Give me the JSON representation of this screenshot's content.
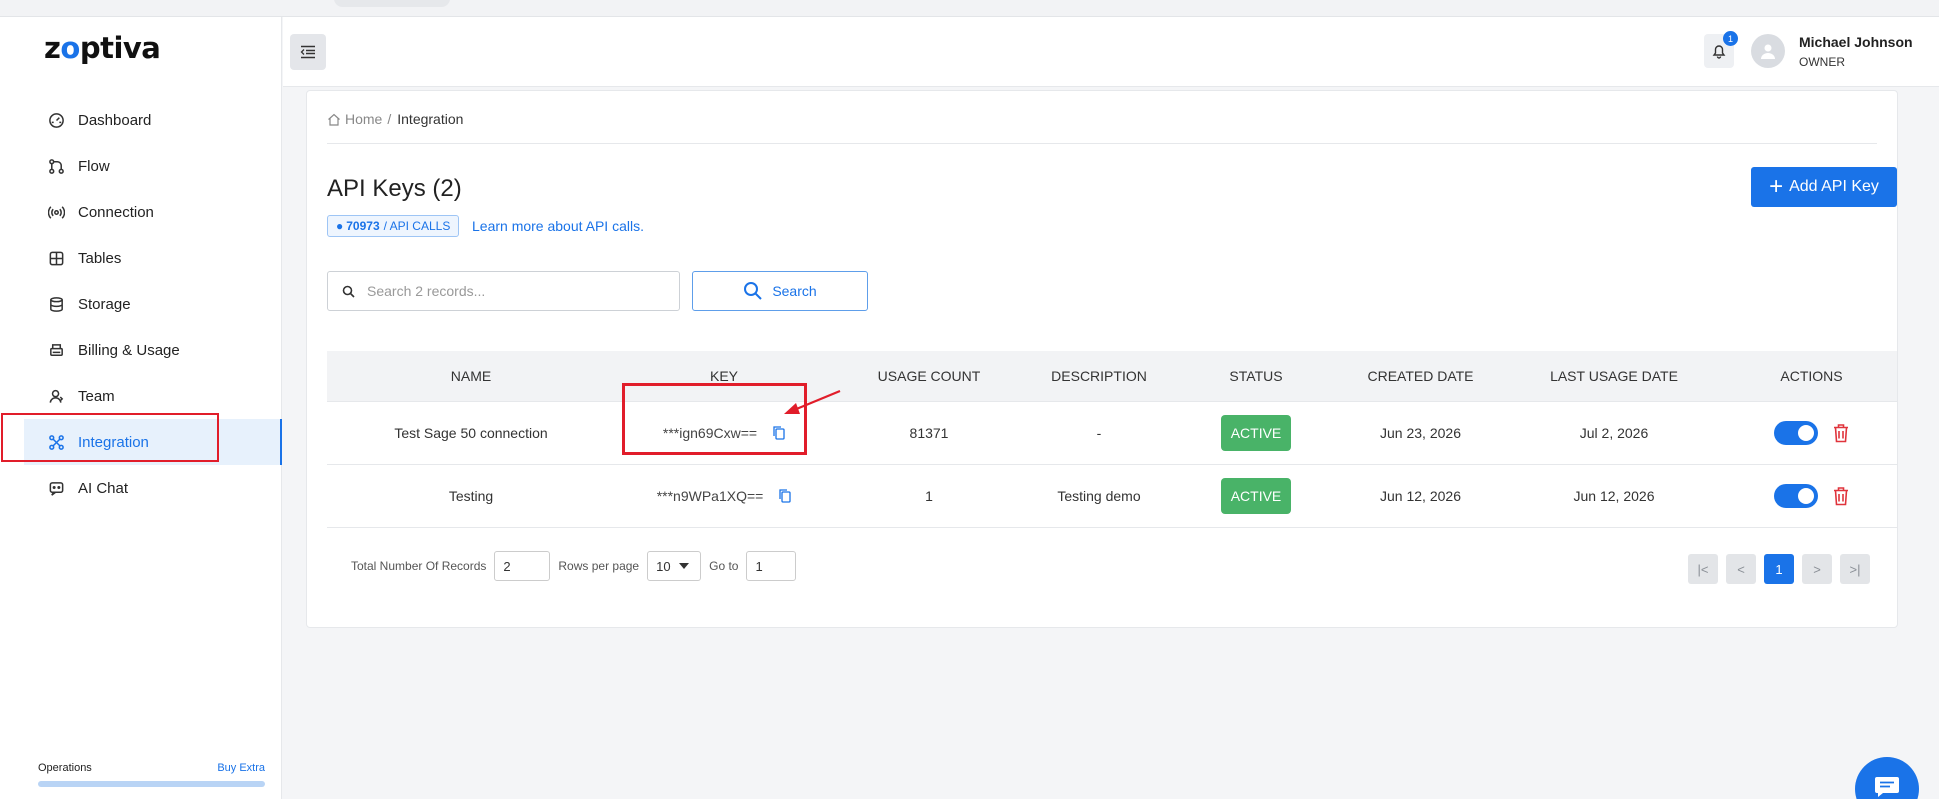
{
  "app": {
    "logo_text_before": "z",
    "logo_o": "o",
    "logo_text_after": "ptiva"
  },
  "sidebar": {
    "items": [
      {
        "label": "Dashboard",
        "icon": "dashboard-icon"
      },
      {
        "label": "Flow",
        "icon": "flow-icon"
      },
      {
        "label": "Connection",
        "icon": "connection-icon"
      },
      {
        "label": "Tables",
        "icon": "tables-icon"
      },
      {
        "label": "Storage",
        "icon": "storage-icon"
      },
      {
        "label": "Billing & Usage",
        "icon": "billing-icon"
      },
      {
        "label": "Team",
        "icon": "team-icon"
      },
      {
        "label": "Integration",
        "icon": "integration-icon",
        "active": true
      },
      {
        "label": "AI Chat",
        "icon": "ai-chat-icon"
      }
    ],
    "operations_label": "Operations",
    "buy_extra_label": "Buy Extra"
  },
  "header": {
    "notification_count": "1",
    "user_name": "Michael Johnson",
    "user_role": "OWNER"
  },
  "breadcrumb": {
    "home": "Home",
    "separator": "/",
    "current": "Integration"
  },
  "page": {
    "title": "API Keys (2)",
    "api_calls_count": "70973",
    "api_calls_label": "/ API CALLS",
    "learn_more": "Learn more about API calls.",
    "add_button": "Add API Key"
  },
  "search": {
    "placeholder": "Search 2 records...",
    "button_label": "Search"
  },
  "table": {
    "headers": [
      "NAME",
      "KEY",
      "USAGE COUNT",
      "DESCRIPTION",
      "STATUS",
      "CREATED DATE",
      "LAST USAGE DATE",
      "ACTIONS"
    ],
    "rows": [
      {
        "name": "Test Sage 50 connection",
        "key": "***ign69Cxw==",
        "usage": "81371",
        "description": "-",
        "status": "ACTIVE",
        "created": "Jun 23, 2026",
        "last_used": "Jul 2, 2026",
        "enabled": true
      },
      {
        "name": "Testing",
        "key": "***n9WPa1XQ==",
        "usage": "1",
        "description": "Testing demo",
        "status": "ACTIVE",
        "created": "Jun 12, 2026",
        "last_used": "Jun 12, 2026",
        "enabled": true
      }
    ]
  },
  "pagination": {
    "total_label": "Total Number Of Records",
    "total_value": "2",
    "rows_label": "Rows per page",
    "rows_value": "10",
    "goto_label": "Go to",
    "goto_value": "1",
    "current_page": "1"
  },
  "colors": {
    "accent": "#1a73e8",
    "status_active": "#49b368",
    "highlight": "#e11d2a",
    "danger": "#e0343c"
  }
}
